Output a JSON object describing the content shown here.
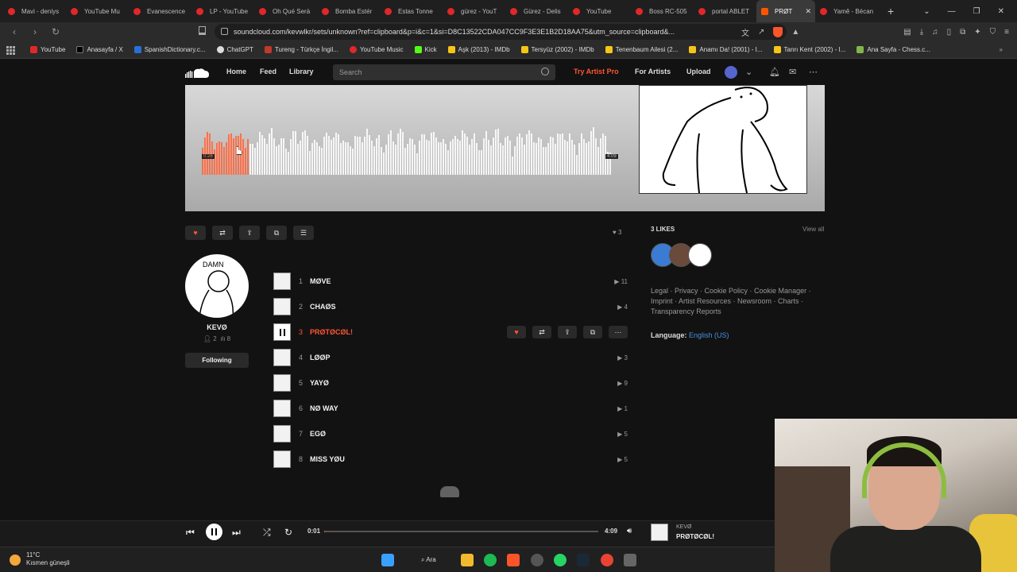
{
  "browser": {
    "tabs": [
      {
        "label": "Mavi - deniys",
        "icon": "youtube-icon"
      },
      {
        "label": "YouTube Mu",
        "icon": "youtube-icon"
      },
      {
        "label": "Evanescence",
        "icon": "youtube-icon"
      },
      {
        "label": "LP - YouTube",
        "icon": "youtube-icon"
      },
      {
        "label": "Oh Qué Serà",
        "icon": "youtube-icon"
      },
      {
        "label": "Bomba Estér",
        "icon": "youtube-icon"
      },
      {
        "label": "Estas Tonne",
        "icon": "youtube-icon"
      },
      {
        "label": "gürez - YouT",
        "icon": "youtube-icon"
      },
      {
        "label": "Gürez - Delis",
        "icon": "youtube-icon"
      },
      {
        "label": "YouTube",
        "icon": "youtube-icon"
      },
      {
        "label": "Boss RC-505",
        "icon": "youtube-icon"
      },
      {
        "label": "portal ABLET",
        "icon": "youtube-icon"
      }
    ],
    "active_tab": {
      "label": "PRØT",
      "icon": "soundcloud-icon"
    },
    "extra_tab": {
      "label": "Yamê - Bécan",
      "icon": "youtube-icon"
    },
    "url": "soundcloud.com/kevwlkr/sets/unknown?ref=clipboard&p=i&c=1&si=D8C13522CDA047CC9F3E3E1B2D18AA75&utm_source=clipboard&...",
    "bookmarks": [
      "YouTube",
      "Anasayfa / X",
      "SpanishDictionary.c...",
      "ChatGPT",
      "Tureng - Türkçe İngil...",
      "YouTube Music",
      "Kick",
      "Aşk (2013) - IMDb",
      "Tersyüz (2002) - IMDb",
      "Tenenbaum Ailesi (2...",
      "Anamı Da! (2001) - I...",
      "Tanrı Kent (2002) - I...",
      "Ana Sayfa - Chess.c..."
    ]
  },
  "sc_header": {
    "nav": [
      "Home",
      "Feed",
      "Library"
    ],
    "search_placeholder": "Search",
    "try_pro": "Try Artist Pro",
    "for_artists": "For Artists",
    "upload": "Upload"
  },
  "hero": {
    "time_start": "0:28",
    "time_end": "4:09"
  },
  "actions": {
    "like_count": "3"
  },
  "likes_panel": {
    "title": "3 LIKES",
    "view_all": "View all",
    "links": "Legal · Privacy · Cookie Policy · Cookie Manager · Imprint · Artist Resources · Newsroom · Charts · Transparency Reports",
    "language_label": "Language:",
    "language_value": "English (US)"
  },
  "profile": {
    "name": "KEVØ",
    "followers": "2",
    "tracks": "8",
    "follow_label": "Following"
  },
  "tracks": [
    {
      "num": "1",
      "title": "MØVE",
      "plays": "11"
    },
    {
      "num": "2",
      "title": "CHAØS",
      "plays": "4"
    },
    {
      "num": "3",
      "title": "PRØTØCØL!",
      "plays": ""
    },
    {
      "num": "4",
      "title": "LØØP",
      "plays": "3"
    },
    {
      "num": "5",
      "title": "YAYØ",
      "plays": "9"
    },
    {
      "num": "6",
      "title": "NØ WAY",
      "plays": "1"
    },
    {
      "num": "7",
      "title": "EGØ",
      "plays": "5"
    },
    {
      "num": "8",
      "title": "MISS YØU",
      "plays": "5"
    }
  ],
  "player": {
    "current_time": "0:01",
    "total_time": "4:09",
    "progress": 0.004,
    "artist": "KEVØ",
    "title": "PRØTØCØL!"
  },
  "taskbar": {
    "temp": "11°C",
    "weather": "Kısmen güneşli",
    "search_label": "Ara"
  },
  "colors": {
    "accent": "#ff5500",
    "like": "#ff5533",
    "link": "#4a90e2"
  }
}
